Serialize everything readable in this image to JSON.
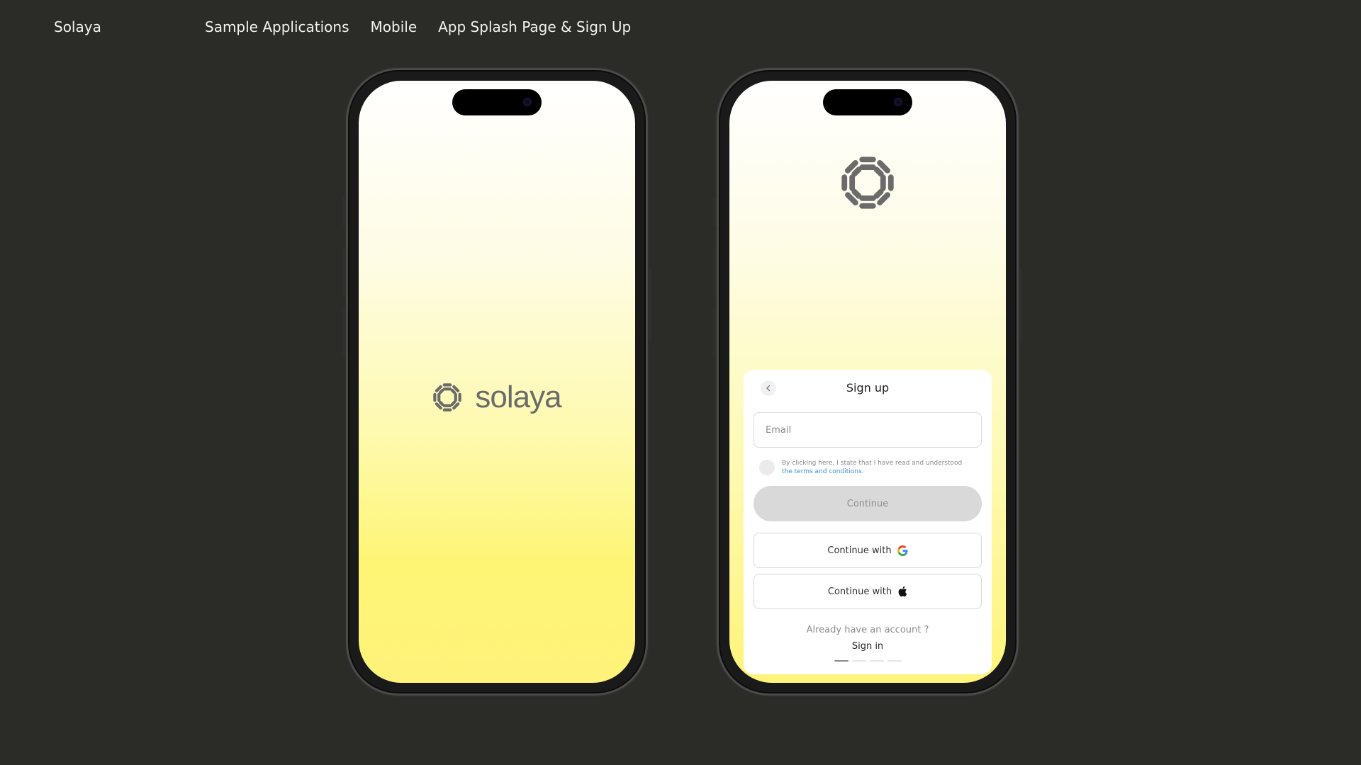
{
  "nav": {
    "brand": "Solaya",
    "breadcrumbs": [
      {
        "label": "Sample Applications"
      },
      {
        "label": "Mobile"
      },
      {
        "label": "App Splash Page & Sign Up"
      }
    ]
  },
  "splash": {
    "wordmark": "solaya",
    "logo_icon": "sun-ring-icon"
  },
  "signup": {
    "logo_icon": "sun-ring-icon",
    "back_icon": "chevron-left-icon",
    "title": "Sign up",
    "email": {
      "placeholder": "Email",
      "value": ""
    },
    "terms": {
      "text": "By clicking here, I state that I have read and understood",
      "link": "the terms and conditions."
    },
    "continue_label": "Continue",
    "google": {
      "label": "Continue with",
      "icon": "google-icon"
    },
    "apple": {
      "label": "Continue with",
      "icon": "apple-icon"
    },
    "already": "Already have an account ?",
    "signin": "Sign in",
    "progress": {
      "steps": 4,
      "current": 1
    }
  },
  "colors": {
    "background": "#2b2b27",
    "nav_text": "#f2f2ee",
    "accent_yellow": "#fff27a",
    "logo_grey": "#6b6b6b",
    "link_blue": "#3a8de0",
    "disabled_button": "#d9d9d9"
  }
}
